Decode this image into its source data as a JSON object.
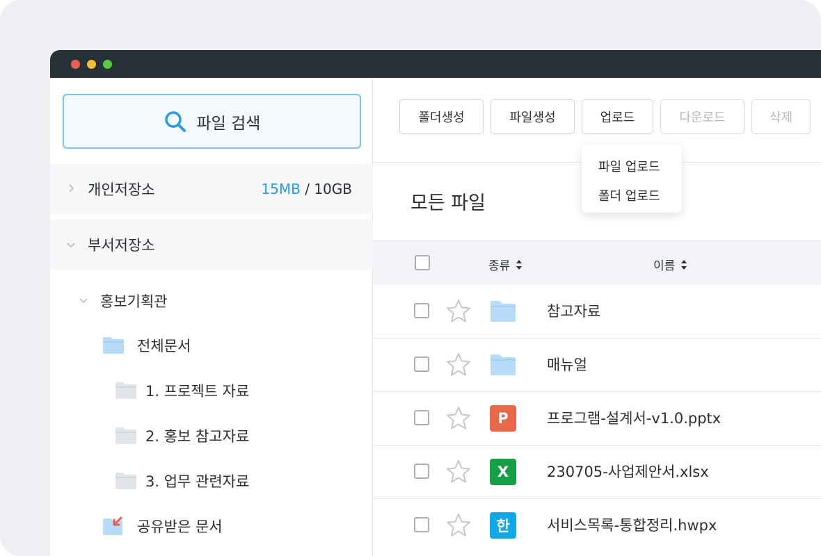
{
  "window": {
    "controls": [
      "close",
      "minimize",
      "maximize"
    ]
  },
  "sidebar": {
    "search_label": "파일 검색",
    "personal": {
      "name": "개인저장소",
      "used": "15MB",
      "separator": " / ",
      "total": "10GB"
    },
    "department": {
      "name": "부서저장소"
    },
    "tree": {
      "group": "홍보기획관",
      "all_docs": "전체문서",
      "folders": [
        "1. 프로젝트 자료",
        "2. 홍보 참고자료",
        "3. 업무 관련자료"
      ],
      "shared": "공유받은 문서"
    }
  },
  "toolbar": {
    "new_folder": "폴더생성",
    "new_file": "파일생성",
    "upload": "업로드",
    "download": "다운로드",
    "delete": "삭제"
  },
  "upload_menu": {
    "file_upload": "파일 업로드",
    "folder_upload": "폴더 업로드"
  },
  "main": {
    "title": "모든 파일"
  },
  "table": {
    "col_type": "종류",
    "col_name": "이름",
    "rows": [
      {
        "icon": "folder-icon",
        "badge": "",
        "name": "참고자료"
      },
      {
        "icon": "folder-icon",
        "badge": "",
        "name": "매뉴얼"
      },
      {
        "icon": "pptx-file-icon",
        "badge": "P",
        "name": "프로그램-설계서-v1.0.pptx"
      },
      {
        "icon": "xlsx-file-icon",
        "badge": "X",
        "name": "230705-사업제안서.xlsx"
      },
      {
        "icon": "hwpx-file-icon",
        "badge": "한",
        "name": "서비스목록-통합정리.hwpx"
      }
    ]
  },
  "colors": {
    "accent": "#2a9ae0",
    "titlebar": "#263238",
    "pptx": "#e9684a",
    "xlsx": "#15a048",
    "hwpx": "#11a8e8"
  }
}
